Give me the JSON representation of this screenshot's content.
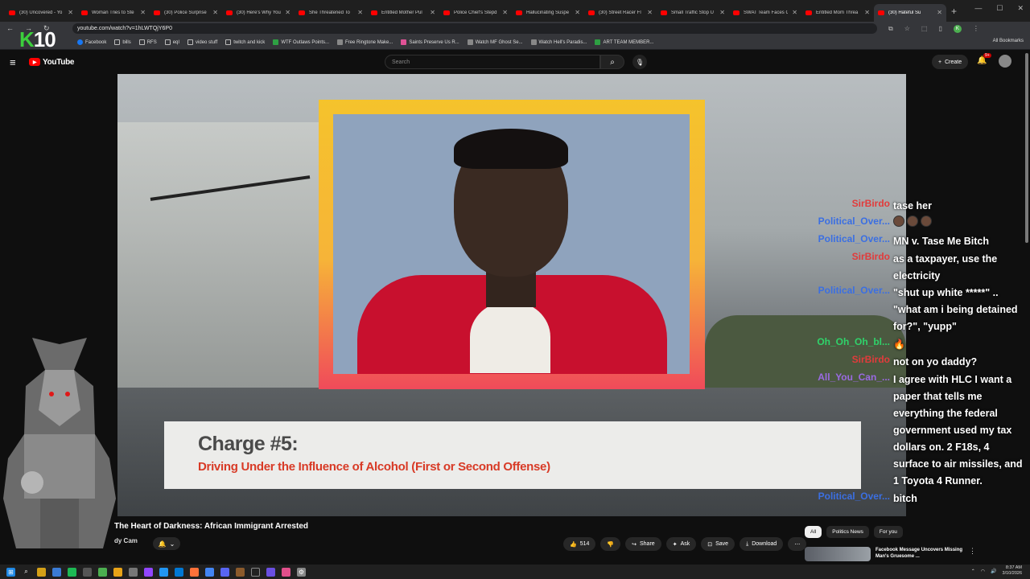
{
  "browser": {
    "tabs": [
      {
        "title": "(30) Uncovered - Yo",
        "active": false
      },
      {
        "title": "Woman Tries to Ste",
        "active": false
      },
      {
        "title": "(30) Police Surprise",
        "active": false
      },
      {
        "title": "(30) Here's Why You",
        "active": false
      },
      {
        "title": "She Threatened To",
        "active": false
      },
      {
        "title": "Entitled Mother Pul",
        "active": false
      },
      {
        "title": "Police Chief's Stepd",
        "active": false
      },
      {
        "title": "Hallucinating Suspe",
        "active": false
      },
      {
        "title": "(30) Street Racer Fl",
        "active": false
      },
      {
        "title": "Small Traffic Stop U",
        "active": false
      },
      {
        "title": "SWAT Team Faces O",
        "active": false
      },
      {
        "title": "Entitled Mom Threa",
        "active": false
      },
      {
        "title": "(30) Hateful Su",
        "active": true
      }
    ],
    "url": "youtube.com/watch?v=1hLWTQjY6P0",
    "profile_initial": "K",
    "bookmarks": [
      {
        "label": "Facebook",
        "icon": "facebook-icon"
      },
      {
        "label": "bills",
        "icon": "folder-icon"
      },
      {
        "label": "RFS",
        "icon": "folder-icon"
      },
      {
        "label": "eqI",
        "icon": "folder-icon"
      },
      {
        "label": "video stuff",
        "icon": "folder-icon"
      },
      {
        "label": "twitch and kick",
        "icon": "folder-icon"
      },
      {
        "label": "WTF Outlaws Points...",
        "icon": "green-plus-icon"
      },
      {
        "label": "Free Ringtone Make...",
        "icon": "page-icon"
      },
      {
        "label": "Saints Preserve Us R...",
        "icon": "pink-icon"
      },
      {
        "label": "Watch MF Ghost Se...",
        "icon": "globe-icon"
      },
      {
        "label": "Watch Hell's Paradis...",
        "icon": "globe-icon"
      },
      {
        "label": "ART TEAM MEMBER...",
        "icon": "green-plus-icon"
      }
    ],
    "all_bookmarks": "All Bookmarks"
  },
  "youtube": {
    "logo_text": "YouTube",
    "search_placeholder": "Search",
    "create_label": "Create",
    "notif_badge": "9+"
  },
  "overlay": {
    "channel_number": "10",
    "channel_letter": "K"
  },
  "video": {
    "caption_title": "Charge #5:",
    "caption_subtitle": "Driving Under the Influence of Alcohol (First or Second Offense)",
    "title": "The Heart of Darkness: African Immigrant Arrested",
    "channel": "dy Cam",
    "likes": "514",
    "actions": [
      "Share",
      "Ask",
      "Save",
      "Download"
    ]
  },
  "chat": [
    {
      "user": "SirBirdo",
      "color": "#e23b3b",
      "text": "tase her"
    },
    {
      "user": "Political_Over...",
      "color": "#3b6fe2",
      "text": "",
      "emotes": 3
    },
    {
      "user": "Political_Over...",
      "color": "#3b6fe2",
      "text": "MN v. Tase Me Bitch"
    },
    {
      "user": "SirBirdo",
      "color": "#e23b3b",
      "text": "as a taxpayer, use the electricity"
    },
    {
      "user": "Political_Over...",
      "color": "#3b6fe2",
      "text": "\"shut up white *****\" .. \"what am i being detained for?\", \"yupp\""
    },
    {
      "user": "Oh_Oh_Oh_bl...",
      "color": "#2fd36a",
      "text": "",
      "emotes": 1
    },
    {
      "user": "SirBirdo",
      "color": "#e23b3b",
      "text": "not on yo daddy?"
    },
    {
      "user": "All_You_Can_...",
      "color": "#9a6ae2",
      "text": "I agree with HLC I want a paper that tells me everything the federal government used my tax dollars on. 2 F18s, 4 surface to air missiles, and 1 Toyota 4 Runner."
    },
    {
      "user": "Political_Over...",
      "color": "#3b6fe2",
      "text": "bitch"
    }
  ],
  "sidebar": {
    "chips": [
      "All",
      "Politics News",
      "For you"
    ],
    "rec_title": "Facebook Message Uncovers Missing Man's Gruesome ..."
  },
  "taskbar": {
    "time": "8:37 AM",
    "date": "3/10/2026"
  }
}
